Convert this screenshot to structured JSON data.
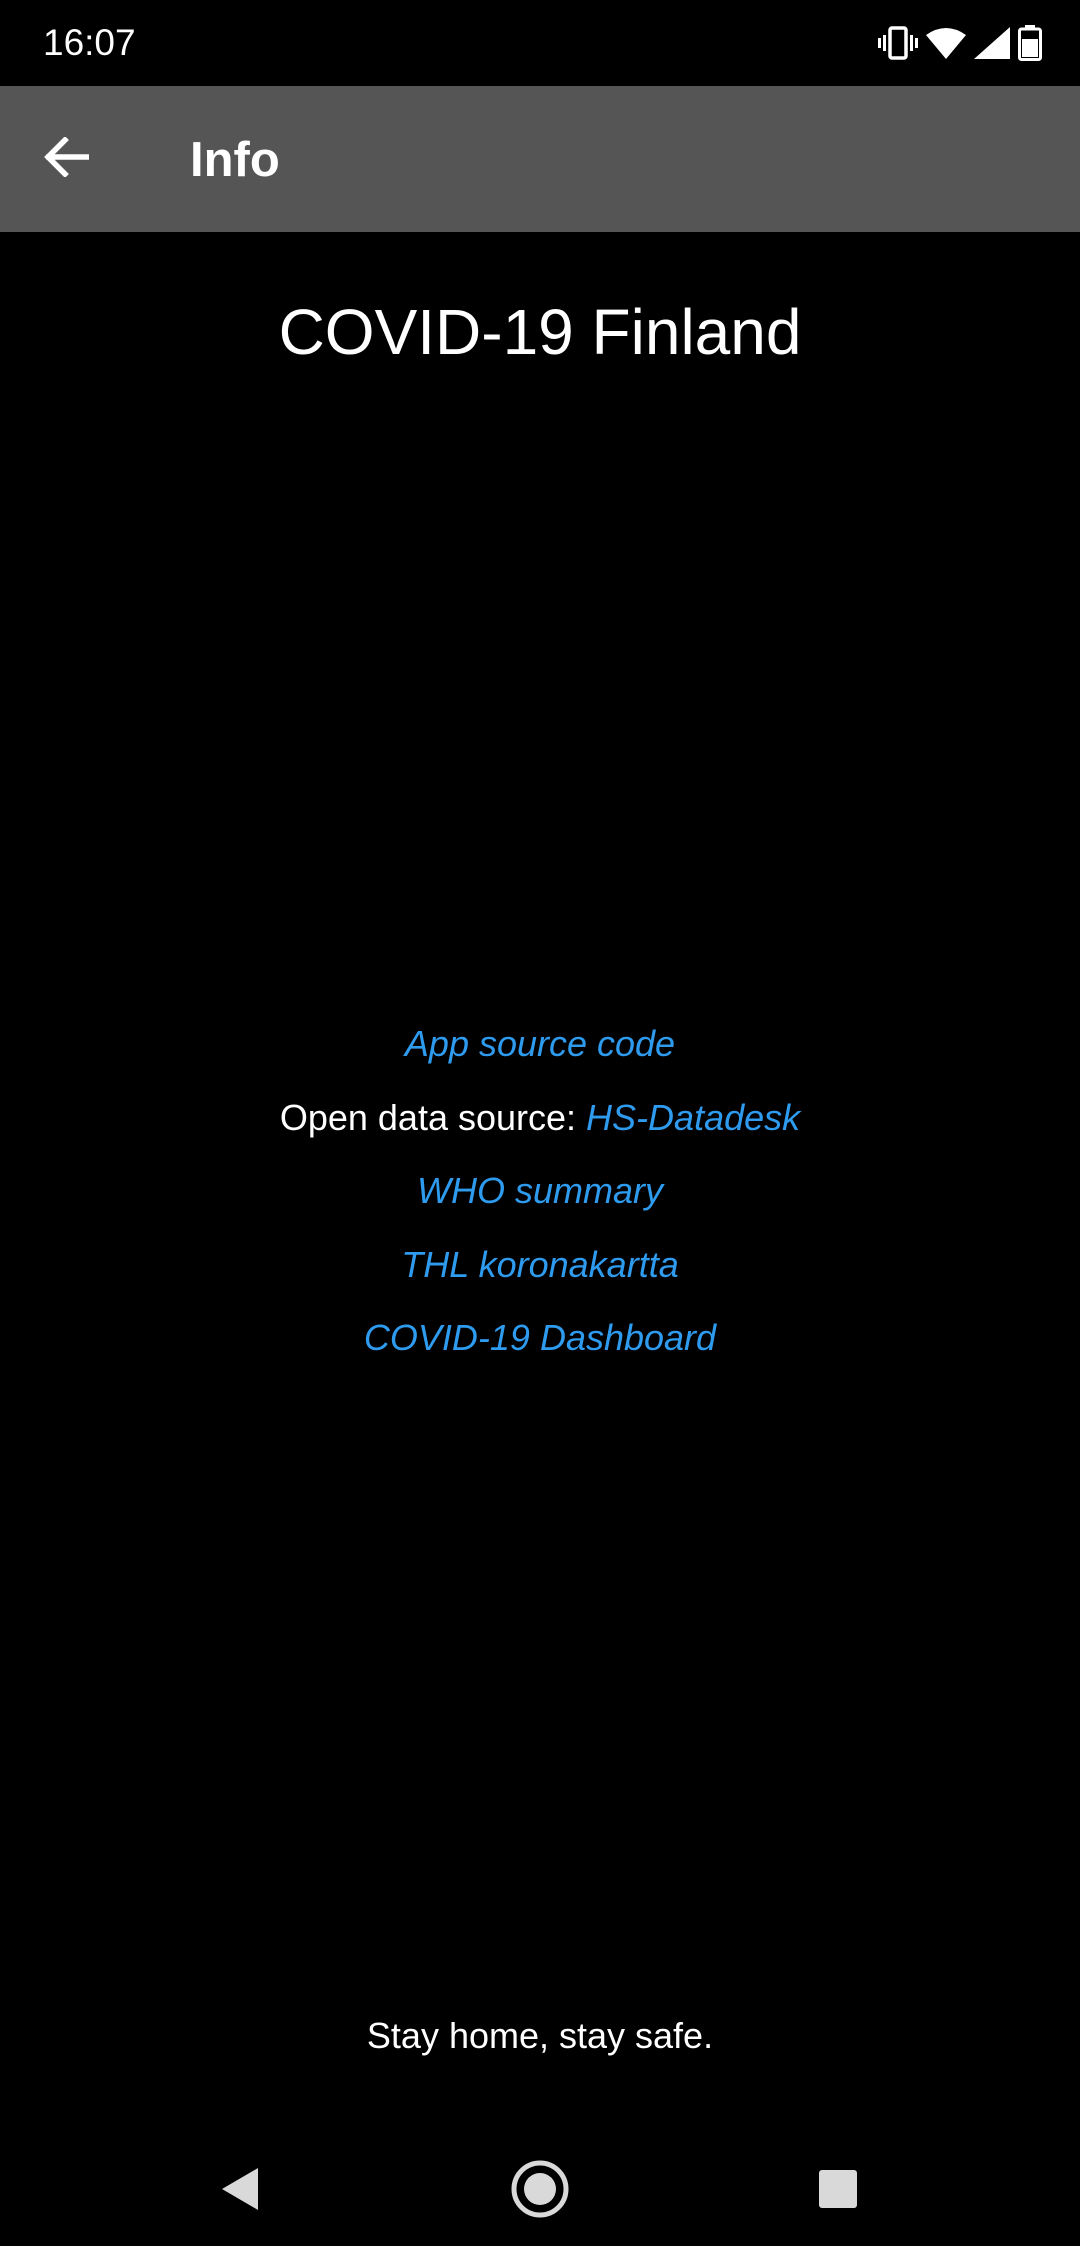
{
  "status_bar": {
    "time": "16:07",
    "icons": [
      "vibrate-icon",
      "wifi-icon",
      "cell-signal-icon",
      "battery-icon"
    ]
  },
  "app_bar": {
    "title": "Info",
    "back_icon": "arrow-left-icon",
    "background_color": "#555555"
  },
  "main": {
    "heading": "COVID-19 Finland",
    "links": {
      "app_source": "App source code",
      "open_data_prefix": "Open data source: ",
      "hs_datadesk": "HS-Datadesk",
      "who_summary": "WHO summary",
      "thl": "THL koronakartta",
      "dashboard": "COVID-19 Dashboard"
    },
    "footer": "Stay home, stay safe.",
    "link_color": "#2e9bef"
  },
  "nav_bar": {
    "icons": [
      "nav-back-icon",
      "nav-home-icon",
      "nav-recents-icon"
    ]
  }
}
